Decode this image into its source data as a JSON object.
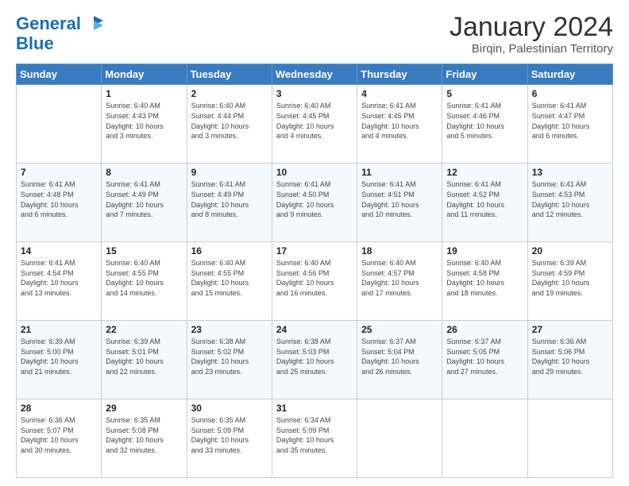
{
  "header": {
    "logo_line1": "General",
    "logo_line2": "Blue",
    "month_title": "January 2024",
    "location": "Birqin, Palestinian Territory"
  },
  "weekdays": [
    "Sunday",
    "Monday",
    "Tuesday",
    "Wednesday",
    "Thursday",
    "Friday",
    "Saturday"
  ],
  "weeks": [
    [
      {
        "day": "",
        "info": ""
      },
      {
        "day": "1",
        "info": "Sunrise: 6:40 AM\nSunset: 4:43 PM\nDaylight: 10 hours\nand 3 minutes."
      },
      {
        "day": "2",
        "info": "Sunrise: 6:40 AM\nSunset: 4:44 PM\nDaylight: 10 hours\nand 3 minutes."
      },
      {
        "day": "3",
        "info": "Sunrise: 6:40 AM\nSunset: 4:45 PM\nDaylight: 10 hours\nand 4 minutes."
      },
      {
        "day": "4",
        "info": "Sunrise: 6:41 AM\nSunset: 4:45 PM\nDaylight: 10 hours\nand 4 minutes."
      },
      {
        "day": "5",
        "info": "Sunrise: 6:41 AM\nSunset: 4:46 PM\nDaylight: 10 hours\nand 5 minutes."
      },
      {
        "day": "6",
        "info": "Sunrise: 6:41 AM\nSunset: 4:47 PM\nDaylight: 10 hours\nand 6 minutes."
      }
    ],
    [
      {
        "day": "7",
        "info": "Sunrise: 6:41 AM\nSunset: 4:48 PM\nDaylight: 10 hours\nand 6 minutes."
      },
      {
        "day": "8",
        "info": "Sunrise: 6:41 AM\nSunset: 4:49 PM\nDaylight: 10 hours\nand 7 minutes."
      },
      {
        "day": "9",
        "info": "Sunrise: 6:41 AM\nSunset: 4:49 PM\nDaylight: 10 hours\nand 8 minutes."
      },
      {
        "day": "10",
        "info": "Sunrise: 6:41 AM\nSunset: 4:50 PM\nDaylight: 10 hours\nand 9 minutes."
      },
      {
        "day": "11",
        "info": "Sunrise: 6:41 AM\nSunset: 4:51 PM\nDaylight: 10 hours\nand 10 minutes."
      },
      {
        "day": "12",
        "info": "Sunrise: 6:41 AM\nSunset: 4:52 PM\nDaylight: 10 hours\nand 11 minutes."
      },
      {
        "day": "13",
        "info": "Sunrise: 6:41 AM\nSunset: 4:53 PM\nDaylight: 10 hours\nand 12 minutes."
      }
    ],
    [
      {
        "day": "14",
        "info": "Sunrise: 6:41 AM\nSunset: 4:54 PM\nDaylight: 10 hours\nand 13 minutes."
      },
      {
        "day": "15",
        "info": "Sunrise: 6:40 AM\nSunset: 4:55 PM\nDaylight: 10 hours\nand 14 minutes."
      },
      {
        "day": "16",
        "info": "Sunrise: 6:40 AM\nSunset: 4:55 PM\nDaylight: 10 hours\nand 15 minutes."
      },
      {
        "day": "17",
        "info": "Sunrise: 6:40 AM\nSunset: 4:56 PM\nDaylight: 10 hours\nand 16 minutes."
      },
      {
        "day": "18",
        "info": "Sunrise: 6:40 AM\nSunset: 4:57 PM\nDaylight: 10 hours\nand 17 minutes."
      },
      {
        "day": "19",
        "info": "Sunrise: 6:40 AM\nSunset: 4:58 PM\nDaylight: 10 hours\nand 18 minutes."
      },
      {
        "day": "20",
        "info": "Sunrise: 6:39 AM\nSunset: 4:59 PM\nDaylight: 10 hours\nand 19 minutes."
      }
    ],
    [
      {
        "day": "21",
        "info": "Sunrise: 6:39 AM\nSunset: 5:00 PM\nDaylight: 10 hours\nand 21 minutes."
      },
      {
        "day": "22",
        "info": "Sunrise: 6:39 AM\nSunset: 5:01 PM\nDaylight: 10 hours\nand 22 minutes."
      },
      {
        "day": "23",
        "info": "Sunrise: 6:38 AM\nSunset: 5:02 PM\nDaylight: 10 hours\nand 23 minutes."
      },
      {
        "day": "24",
        "info": "Sunrise: 6:38 AM\nSunset: 5:03 PM\nDaylight: 10 hours\nand 25 minutes."
      },
      {
        "day": "25",
        "info": "Sunrise: 6:37 AM\nSunset: 5:04 PM\nDaylight: 10 hours\nand 26 minutes."
      },
      {
        "day": "26",
        "info": "Sunrise: 6:37 AM\nSunset: 5:05 PM\nDaylight: 10 hours\nand 27 minutes."
      },
      {
        "day": "27",
        "info": "Sunrise: 6:36 AM\nSunset: 5:06 PM\nDaylight: 10 hours\nand 29 minutes."
      }
    ],
    [
      {
        "day": "28",
        "info": "Sunrise: 6:36 AM\nSunset: 5:07 PM\nDaylight: 10 hours\nand 30 minutes."
      },
      {
        "day": "29",
        "info": "Sunrise: 6:35 AM\nSunset: 5:08 PM\nDaylight: 10 hours\nand 32 minutes."
      },
      {
        "day": "30",
        "info": "Sunrise: 6:35 AM\nSunset: 5:09 PM\nDaylight: 10 hours\nand 33 minutes."
      },
      {
        "day": "31",
        "info": "Sunrise: 6:34 AM\nSunset: 5:09 PM\nDaylight: 10 hours\nand 35 minutes."
      },
      {
        "day": "",
        "info": ""
      },
      {
        "day": "",
        "info": ""
      },
      {
        "day": "",
        "info": ""
      }
    ]
  ]
}
